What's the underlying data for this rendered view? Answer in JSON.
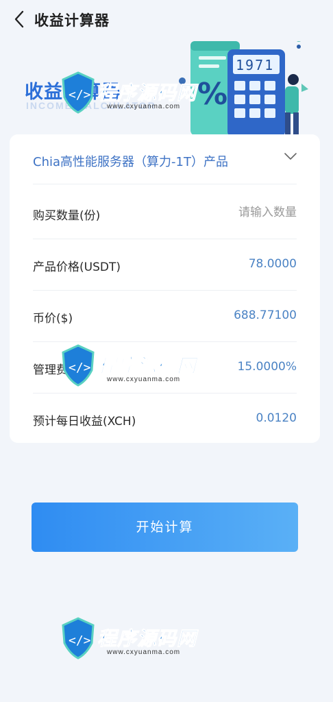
{
  "header": {
    "title": "收益计算器",
    "back_icon": "chevron-left-icon"
  },
  "banner": {
    "title": "收益计算器",
    "subtitle": "INCOME CALCULATOR",
    "calculator_display": "1971",
    "percent_symbol": "%"
  },
  "card": {
    "product": {
      "label": "Chia高性能服务器（算力-1T）产品",
      "icon": "chevron-down-icon"
    },
    "rows": [
      {
        "label": "购买数量(份)",
        "placeholder": "请输入数量",
        "value": ""
      },
      {
        "label": "产品价格(USDT)",
        "value": "78.0000"
      },
      {
        "label": "币价($)",
        "value": "688.77100"
      },
      {
        "label": "管理费(%)",
        "value": "15.0000%"
      },
      {
        "label": "预计每日收益(XCH)",
        "value": "0.0120"
      }
    ]
  },
  "button": {
    "label": "开始计算"
  },
  "watermark": {
    "text": "程序源码网",
    "url": "www.cxyuanma.com"
  },
  "colors": {
    "accent": "#2f8cf2",
    "value_blue": "#4b83c4",
    "background": "#f2f5fa"
  }
}
